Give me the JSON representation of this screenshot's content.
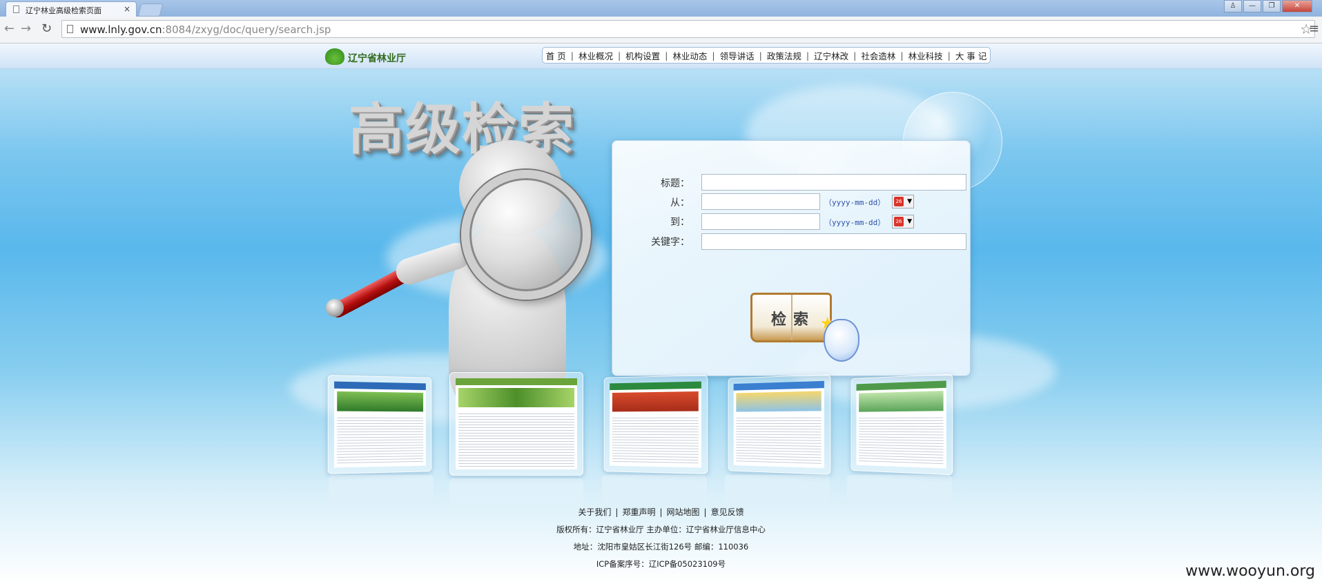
{
  "browser": {
    "tab_title": "辽宁林业高级检索页面",
    "tab_close": "×",
    "url_host": "www.lnly.gov.cn",
    "url_path": ":8084/zxyg/doc/query/search.jsp",
    "back": "←",
    "forward": "→",
    "reload": "↻",
    "star": "☆",
    "menu": "≡",
    "window_buttons": [
      "♙",
      "—",
      "❐",
      "✕"
    ]
  },
  "header": {
    "logo_text": "辽宁省林业厅",
    "nav": [
      "首 页",
      "林业概况",
      "机构设置",
      "林业动态",
      "领导讲话",
      "政策法规",
      "辽宁林改",
      "社会造林",
      "林业科技",
      "大 事 记"
    ],
    "nav_separator": "|"
  },
  "hero": {
    "title": "高级检索"
  },
  "search_form": {
    "title_label": "标题：",
    "title_value": "",
    "from_label": "从：",
    "from_value": "",
    "to_label": "到：",
    "to_value": "",
    "date_hint": "（yyyy-mm-dd）",
    "keyword_label": "关键字：",
    "keyword_value": "",
    "calendar_icon_text": "26",
    "dropdown_arrow": "▼",
    "submit_label": "检索"
  },
  "footer": {
    "links": [
      "关于我们",
      "郑重声明",
      "网站地图",
      "意见反馈"
    ],
    "link_separator": "|",
    "copyright": "版权所有：辽宁省林业厅 主办单位：辽宁省林业厅信息中心",
    "address": "地址：沈阳市皇姑区长江街126号 邮编：110036",
    "icp": "ICP备案序号：辽ICP备05023109号"
  },
  "watermark": "www.wooyun.org",
  "colors": {
    "accent": "#3a78c8",
    "sky": "#59b8ec",
    "hint": "#2c4fa8"
  }
}
